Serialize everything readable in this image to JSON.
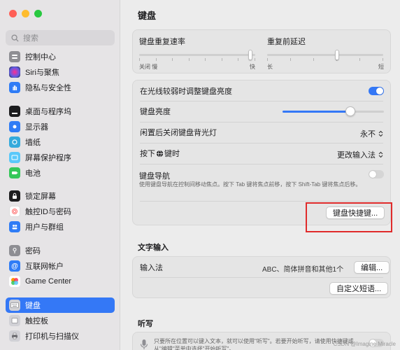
{
  "sidebar": {
    "search_placeholder": "搜索",
    "items": [
      {
        "label": "控制中心",
        "icon": "control-center-icon",
        "color": "#8e8e93"
      },
      {
        "label": "Siri与聚焦",
        "icon": "siri-icon",
        "color": "#2d2d2d"
      },
      {
        "label": "隐私与安全性",
        "icon": "hand-icon",
        "color": "#2f7cf6"
      },
      {
        "label": "桌面与程序坞",
        "icon": "dock-icon",
        "color": "#1c1c1e"
      },
      {
        "label": "显示器",
        "icon": "sun-icon",
        "color": "#2f7cf6"
      },
      {
        "label": "墙纸",
        "icon": "flower-icon",
        "color": "#34aadc"
      },
      {
        "label": "屏幕保护程序",
        "icon": "screensaver-icon",
        "color": "#5ac8fa"
      },
      {
        "label": "电池",
        "icon": "battery-icon",
        "color": "#34c759"
      },
      {
        "label": "锁定屏幕",
        "icon": "lock-icon",
        "color": "#1c1c1e"
      },
      {
        "label": "触控ID与密码",
        "icon": "fingerprint-icon",
        "color": "#ff6b6b"
      },
      {
        "label": "用户与群组",
        "icon": "users-icon",
        "color": "#2f7cf6"
      },
      {
        "label": "密码",
        "icon": "key-icon",
        "color": "#8e8e93"
      },
      {
        "label": "互联网帐户",
        "icon": "at-icon",
        "color": "#2f7cf6"
      },
      {
        "label": "Game Center",
        "icon": "game-center-icon",
        "color": "#ffffff"
      },
      {
        "label": "键盘",
        "icon": "keyboard-icon",
        "color": "#8e8e93",
        "selected": true
      },
      {
        "label": "触控板",
        "icon": "trackpad-icon",
        "color": "#8e8e93"
      },
      {
        "label": "打印机与扫描仪",
        "icon": "printer-icon",
        "color": "#8e8e93"
      }
    ]
  },
  "main": {
    "title": "键盘",
    "repeat": {
      "label": "键盘重复速率",
      "left_labels": "关闭   慢",
      "right_label": "快",
      "value": 0.96
    },
    "delay": {
      "label": "重复前延迟",
      "left_label": "长",
      "right_label": "短",
      "value": 0.6
    },
    "backlight_adjust": {
      "label": "在光线较弱时调整键盘亮度",
      "on": true
    },
    "brightness": {
      "label": "键盘亮度",
      "value": 0.67
    },
    "backlight_off": {
      "label": "闲置后关闭键盘背光灯",
      "value": "永不"
    },
    "press_key": {
      "label_prefix": "按下",
      "label_suffix": "键时",
      "value": "更改输入法"
    },
    "keyboard_nav": {
      "label": "键盘导航",
      "description": "使用键盘导航在控制间移动焦点。按下 Tab 键将焦点前移，按下 Shift-Tab 键将焦点后移。",
      "on": false
    },
    "shortcuts_button": "键盘快捷键...",
    "text_input": {
      "title": "文字输入",
      "input_source_label": "输入法",
      "input_source_value": "ABC、简体拼音和其他1个",
      "edit_button": "编辑...",
      "custom_phrases_button": "自定义短语..."
    },
    "dictation": {
      "title": "听写",
      "description": "只要所在位置可以键入文本，就可以使用\"听写\"。若要开始听写，请使用快捷键或从\"编辑\"菜单中选择\"开始听写\"。"
    }
  },
  "watermark": "CSDN @Imagine Miracle",
  "colors": {
    "accent": "#3478f6",
    "highlight": "#e02b2b"
  }
}
